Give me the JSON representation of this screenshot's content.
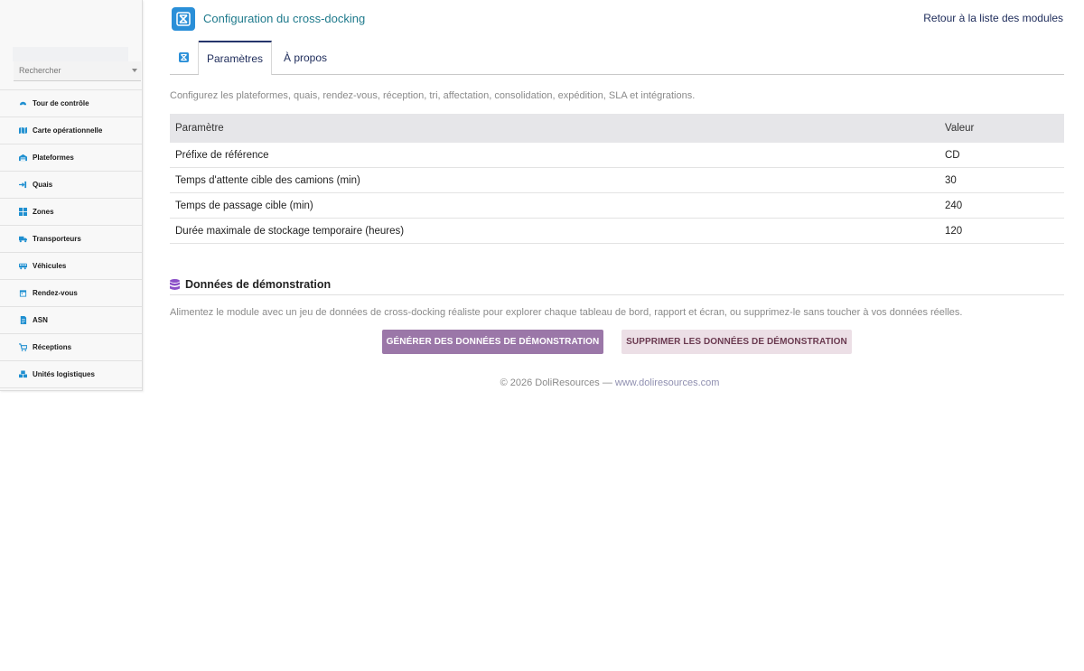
{
  "sidebar": {
    "search_placeholder": "Rechercher",
    "items": [
      {
        "label": "Tour de contrôle",
        "icon": "dashboard-icon"
      },
      {
        "label": "Carte opérationnelle",
        "icon": "map-icon"
      },
      {
        "label": "Plateformes",
        "icon": "warehouse-icon"
      },
      {
        "label": "Quais",
        "icon": "dock-icon"
      },
      {
        "label": "Zones",
        "icon": "grid-icon"
      },
      {
        "label": "Transporteurs",
        "icon": "truck-icon"
      },
      {
        "label": "Véhicules",
        "icon": "vehicle-icon"
      },
      {
        "label": "Rendez-vous",
        "icon": "calendar-icon"
      },
      {
        "label": "ASN",
        "icon": "document-icon"
      },
      {
        "label": "Réceptions",
        "icon": "receipt-cart-icon"
      },
      {
        "label": "Unités logistiques",
        "icon": "pallets-icon"
      }
    ]
  },
  "header": {
    "title": "Configuration du cross-docking",
    "back_link": "Retour à la liste des modules"
  },
  "tabs": [
    {
      "label": "Paramètres",
      "active": true
    },
    {
      "label": "À propos",
      "active": false
    }
  ],
  "intro": "Configurez les plateformes, quais, rendez-vous, réception, tri, affectation, consolidation, expédition, SLA et intégrations.",
  "table": {
    "headers": [
      "Paramètre",
      "Valeur"
    ],
    "rows": [
      [
        "Préfixe de référence",
        "CD"
      ],
      [
        "Temps d'attente cible des camions (min)",
        "30"
      ],
      [
        "Temps de passage cible (min)",
        "240"
      ],
      [
        "Durée maximale de stockage temporaire (heures)",
        "120"
      ]
    ]
  },
  "demo": {
    "title": "Données de démonstration",
    "description": "Alimentez le module avec un jeu de données de cross-docking réaliste pour explorer chaque tableau de bord, rapport et écran, ou supprimez-le sans toucher à vos données réelles.",
    "generate_label": "GÉNÉRER DES DONNÉES DE DÉMONSTRATION",
    "delete_label": "SUPPRIMER LES DONNÉES DE DÉMONSTRATION"
  },
  "footer": {
    "text": "© 2026 DoliResources — ",
    "link": "www.doliresources.com"
  },
  "colors": {
    "accent": "#1f7a8c",
    "sidebar_icon": "#1f8fd0",
    "generate_button": "#9b77a8",
    "delete_button": "#ecdfe6",
    "demo_icon": "#8b4fc8"
  }
}
